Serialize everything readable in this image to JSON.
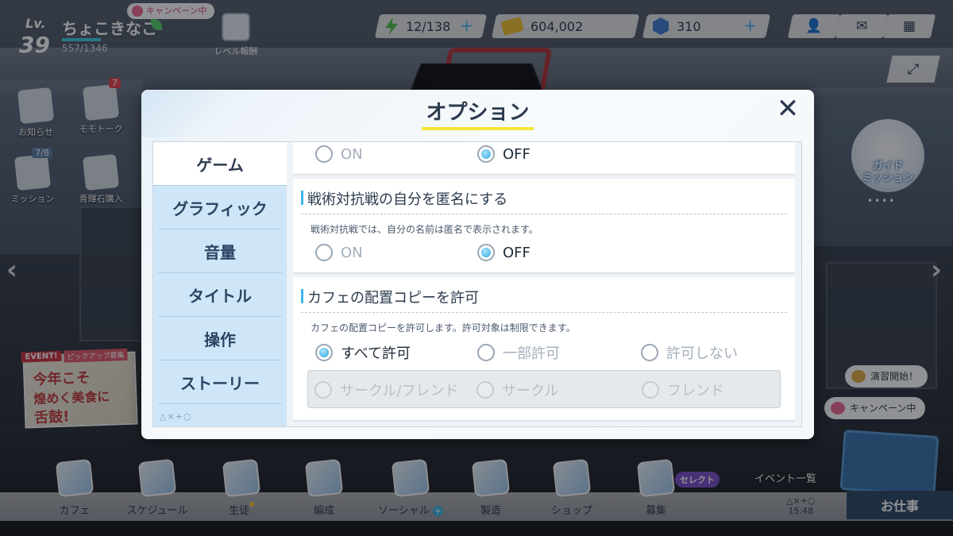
{
  "player": {
    "level_label": "Lv.",
    "level": "39",
    "name": "ちょこきなこ",
    "exp": "557/1346",
    "exp_fraction": 0.41,
    "campaign": "キャンペーン中"
  },
  "level_reward": {
    "label": "レベル報酬"
  },
  "resources": {
    "ap": "12/138",
    "credits": "604,002",
    "gems": "310",
    "plus": "+"
  },
  "top_buttons": {
    "profile": "👤",
    "mail": "✉",
    "menu": "▦"
  },
  "side_menu": {
    "news": "お知らせ",
    "momotalk": "モモトーク",
    "momotalk_badge": "7",
    "mission": "ミッション",
    "mission_badge": "7/8",
    "shop_gem": "青輝石購入"
  },
  "event_banner": {
    "tag": "EVENT!",
    "tag2": "ピックアップ募集",
    "line1": "今年こそ",
    "line2": "煌めく美食に",
    "line3": "舌鼓!"
  },
  "right_side": {
    "expand_icon": "⤢",
    "guide_line1": "ガイド",
    "guide_line2": "ミッション",
    "dots": "••••",
    "drill": "演習開始！",
    "campaign": "キャンペーン中"
  },
  "bottom_nav": {
    "cafe": "カフェ",
    "schedule": "スケジュール",
    "students": "生徒",
    "formation": "編成",
    "social": "ソーシャル",
    "social_plus": "+",
    "craft": "製造",
    "shop": "ショップ",
    "recruit": "募集",
    "select": "セレクト",
    "event_list": "イベント一覧",
    "time_symbols": "△×+○",
    "time": "15:48",
    "job": "お仕事"
  },
  "nav_arrows": {
    "left": "‹",
    "right": "›"
  },
  "dialog": {
    "title": "オプション",
    "close": "✕",
    "tabs": [
      "ゲーム",
      "グラフィック",
      "音量",
      "タイトル",
      "操作",
      "ストーリー"
    ],
    "tab_footer": "△×+○",
    "settings": {
      "first": {
        "on": "ON",
        "off": "OFF",
        "selected": "OFF"
      },
      "anonymous": {
        "title": "戦術対抗戦の自分を匿名にする",
        "desc": "戦術対抗戦では、自分の名前は匿名で表示されます。",
        "on": "ON",
        "off": "OFF",
        "selected": "OFF"
      },
      "cafe_copy": {
        "title": "カフェの配置コピーを許可",
        "desc": "カフェの配置コピーを許可します。許可対象は制限できます。",
        "all": "すべて許可",
        "partial": "一部許可",
        "none": "許可しない",
        "selected": "すべて許可",
        "sub_circle_friend": "サークル/フレンド",
        "sub_circle": "サークル",
        "sub_friend": "フレンド"
      }
    }
  },
  "colors": {
    "accent": "#3db5e8",
    "title_underline": "#f5e53a",
    "tab_bg": "#cfe6f8",
    "text_dark": "#2b3a4d"
  }
}
